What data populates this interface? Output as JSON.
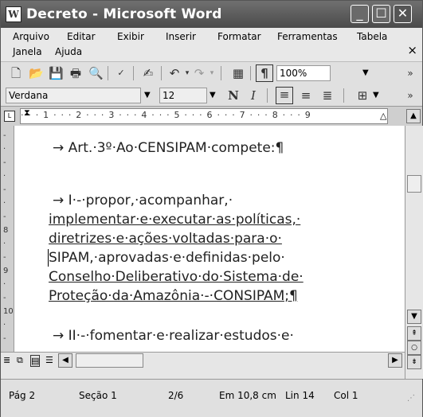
{
  "window": {
    "title": "Decreto - Microsoft Word",
    "app_icon": "W"
  },
  "menu": {
    "items": [
      "Arquivo",
      "Editar",
      "Exibir",
      "Inserir",
      "Formatar",
      "Ferramentas",
      "Tabela",
      "Janela",
      "Ajuda"
    ],
    "close_symbol": "×"
  },
  "toolbar": {
    "zoom": "100%",
    "font_name": "Verdana",
    "font_size": "12",
    "pilcrow": "¶",
    "bold": "N",
    "italic": "I"
  },
  "document": {
    "paragraph1": "→  Art.·3º·Ao·CENSIPAM·compete:¶",
    "paragraph2_lines": [
      "→  I·-·propor,·acompanhar,·",
      "implementar·e·executar·as·políticas,·",
      "diretrizes·e·ações·voltadas·para·o·",
      "SIPAM,·aprovadas·e·definidas·pelo·",
      "Conselho·Deliberativo·do·Sistema·de·",
      "Proteção·da·Amazônia·-·CONSIPAM;¶"
    ],
    "paragraph3": "→  II·-·fomentar·e·realizar·estudos·e·"
  },
  "status": {
    "page": "Pág 2",
    "section": "Seção 1",
    "page_of": "2/6",
    "position": "Em 10,8 cm",
    "line": "Lin 14",
    "column": "Col 1"
  }
}
